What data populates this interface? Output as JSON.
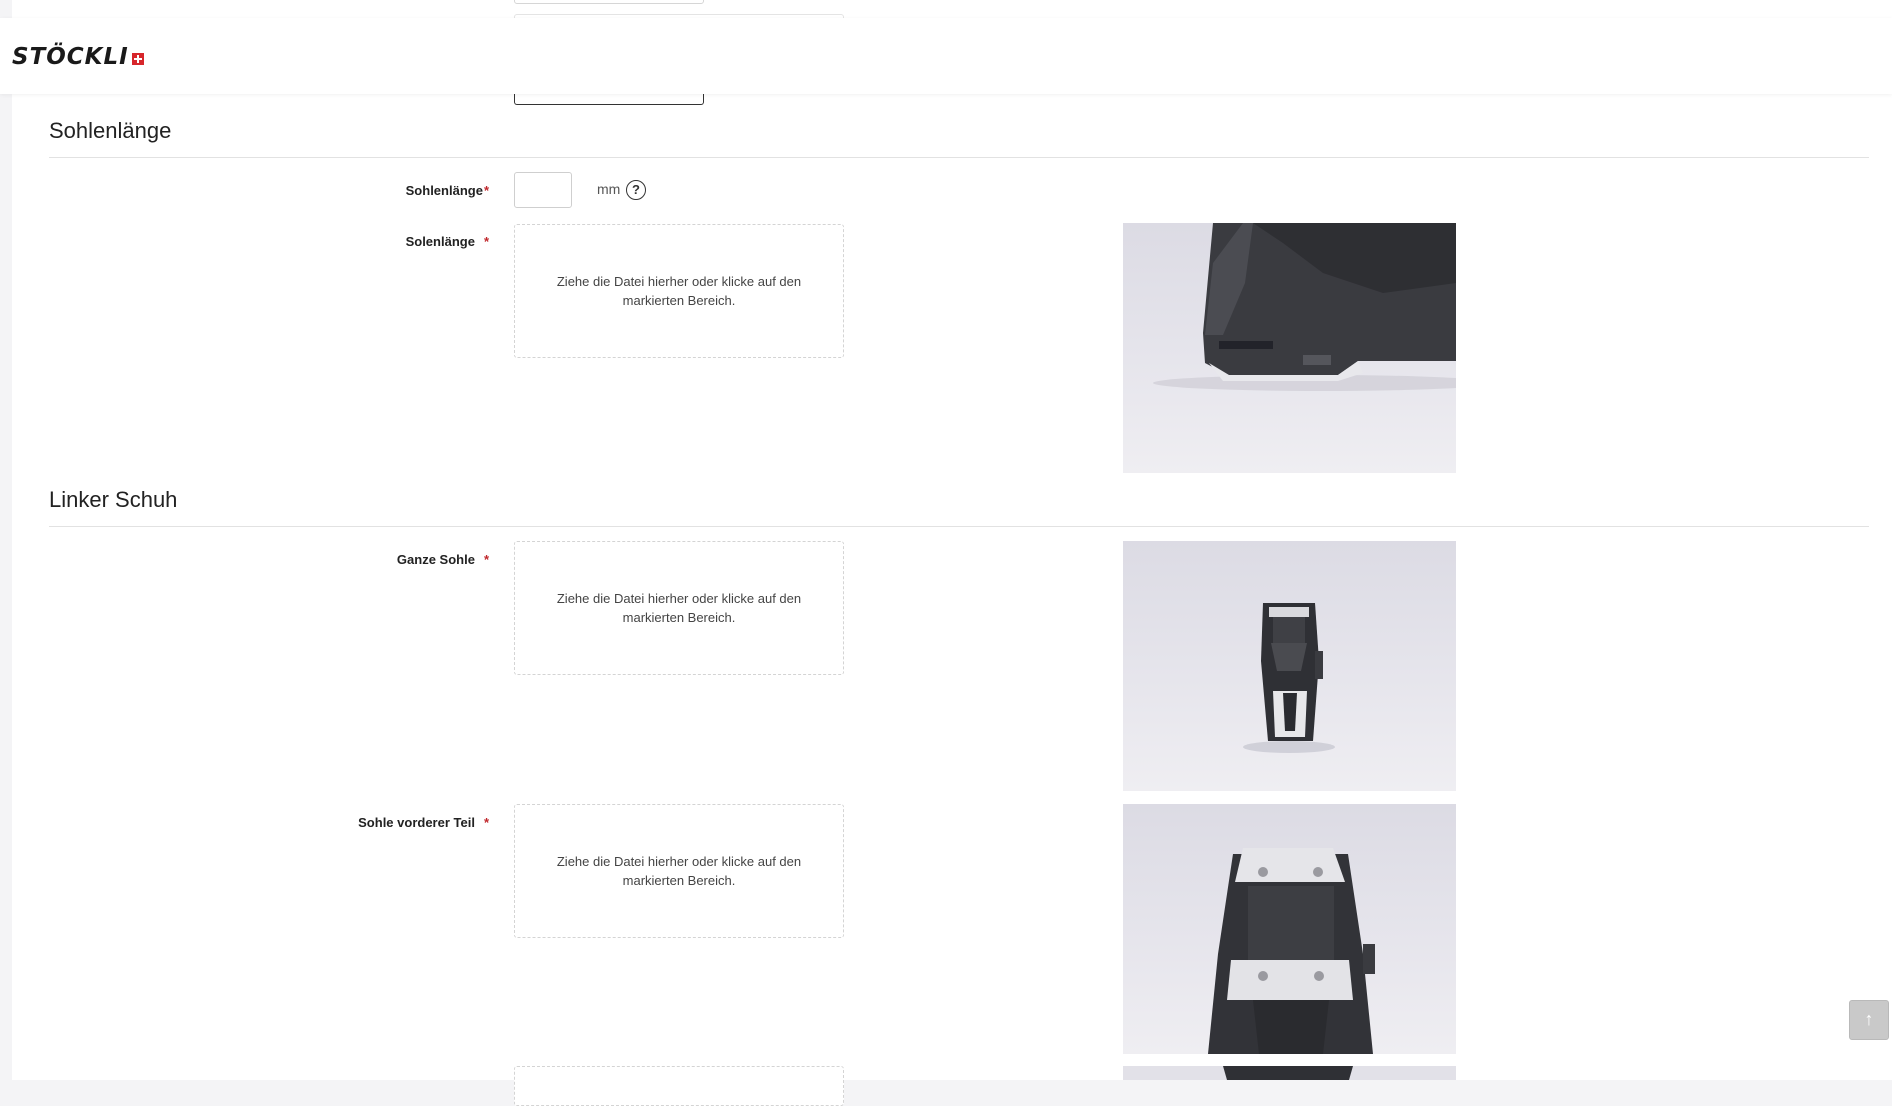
{
  "brand": {
    "logo_text": "STÖCKLI",
    "logo_cross_color": "#d7262b"
  },
  "sections": {
    "sohlenlaenge": {
      "title": "Sohlenlänge",
      "length_field": {
        "label": "Sohlenlänge",
        "required_mark": "*",
        "value": "",
        "unit": "mm",
        "help_icon": "question-circle-icon"
      },
      "upload": {
        "label": "Solenlänge",
        "required_mark": "*",
        "dropzone_text": "Ziehe die Datei hierher oder klicke auf den markierten Bereich."
      }
    },
    "linker_schuh": {
      "title": "Linker Schuh",
      "ganze_sohle": {
        "label": "Ganze Sohle",
        "required_mark": "*",
        "dropzone_text": "Ziehe die Datei hierher oder klicke auf den markierten Bereich."
      },
      "sohle_vorderer_teil": {
        "label": "Sohle vorderer Teil",
        "required_mark": "*",
        "dropzone_text": "Ziehe die Datei hierher oder klicke auf den markierten Bereich."
      }
    }
  },
  "scroll_top_icon": "arrow-up-icon",
  "colors": {
    "required": "#c0262b",
    "divider": "#e2e2e2"
  }
}
